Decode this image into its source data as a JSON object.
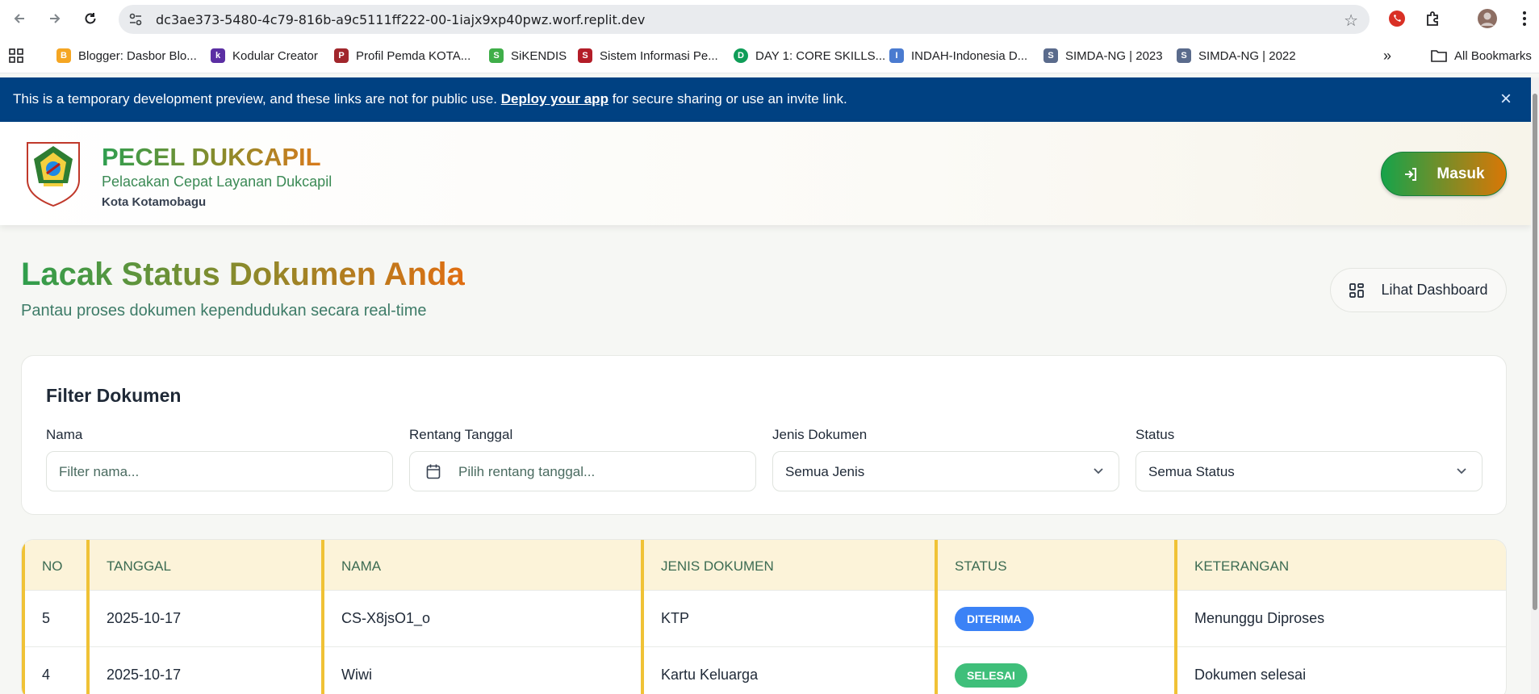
{
  "browser": {
    "url": "dc3ae373-5480-4c79-816b-a9c5111ff222-00-1iajx9xp40pwz.worf.replit.dev",
    "bookmarks": [
      {
        "label": "Blogger: Dasbor Blo...",
        "color": "#f5a623",
        "letter": "B"
      },
      {
        "label": "Kodular Creator",
        "color": "#5b2fa3",
        "letter": "k"
      },
      {
        "label": "Profil Pemda KOTA...",
        "color": "#a1262c",
        "letter": "P"
      },
      {
        "label": "SiKENDIS",
        "color": "#3fae49",
        "letter": "S"
      },
      {
        "label": "Sistem Informasi Pe...",
        "color": "#b31d28",
        "letter": "S"
      },
      {
        "label": "DAY 1: CORE SKILLS...",
        "color": "#0f9d58",
        "letter": "D"
      },
      {
        "label": "INDAH-Indonesia D...",
        "color": "#4a7bd0",
        "letter": "I"
      },
      {
        "label": "SIMDA-NG | 2023",
        "color": "#5a6b8c",
        "letter": "S"
      },
      {
        "label": "SIMDA-NG | 2022",
        "color": "#5a6b8c",
        "letter": "S"
      }
    ],
    "more_label": "»",
    "all_bookmarks": "All Bookmarks"
  },
  "banner": {
    "text_before": "This is a temporary development preview, and these links are not for public use.",
    "link": "Deploy your app",
    "text_after": "for secure sharing or use an invite link.",
    "close": "×"
  },
  "header": {
    "title": "PECEL DUKCAPIL",
    "subtitle": "Pelacakan Cepat Layanan Dukcapil",
    "city": "Kota Kotamobagu",
    "login_label": "Masuk"
  },
  "main": {
    "title": "Lacak Status Dokumen Anda",
    "subtitle": "Pantau proses dokumen kependudukan secara real-time",
    "dashboard_label": "Lihat Dashboard"
  },
  "filter": {
    "title": "Filter Dokumen",
    "name_label": "Nama",
    "name_placeholder": "Filter nama...",
    "date_label": "Rentang Tanggal",
    "date_placeholder": "Pilih rentang tanggal...",
    "type_label": "Jenis Dokumen",
    "type_value": "Semua Jenis",
    "status_label": "Status",
    "status_value": "Semua Status"
  },
  "table": {
    "headers": [
      "NO",
      "TANGGAL",
      "NAMA",
      "JENIS DOKUMEN",
      "STATUS",
      "KETERANGAN"
    ],
    "rows": [
      {
        "no": "5",
        "tanggal": "2025-10-17",
        "nama": "CS-X8jsO1_o",
        "jenis": "KTP",
        "status": "DITERIMA",
        "status_color": "#3b82f6",
        "keterangan": "Menunggu Diproses"
      },
      {
        "no": "4",
        "tanggal": "2025-10-17",
        "nama": "Wiwi",
        "jenis": "Kartu Keluarga",
        "status": "SELESAI",
        "status_color": "#3fbf7a",
        "keterangan": "Dokumen selesai"
      }
    ]
  }
}
